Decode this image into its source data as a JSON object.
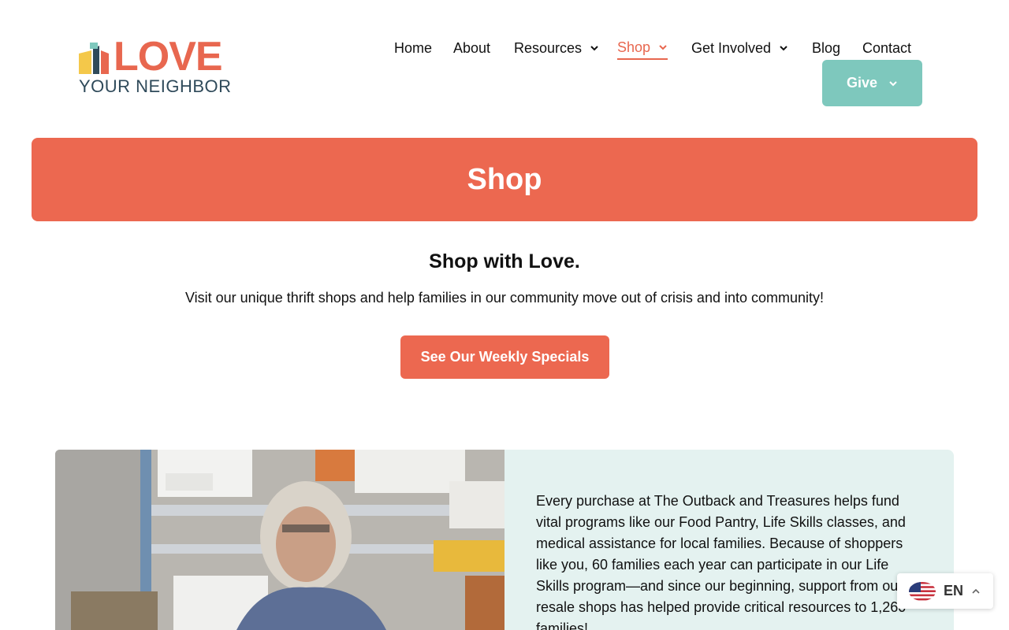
{
  "brand": {
    "word_love": "LOVE",
    "word_neighbor": "YOUR NEIGHBOR",
    "colors": {
      "coral": "#e8674f",
      "teal": "#7ec8bd",
      "navy": "#2f4a5a",
      "yellow": "#f4c84a",
      "mint_panel": "#e4f2f0"
    }
  },
  "nav": {
    "items": [
      {
        "label": "Home",
        "dropdown": false
      },
      {
        "label": "About",
        "dropdown": false
      },
      {
        "label": "Resources",
        "dropdown": true
      },
      {
        "label": "Shop",
        "dropdown": true,
        "active": true
      },
      {
        "label": "Get Involved",
        "dropdown": true
      },
      {
        "label": "Blog",
        "dropdown": false
      },
      {
        "label": "Contact",
        "dropdown": false
      }
    ],
    "give_label": "Give"
  },
  "banner": {
    "title": "Shop"
  },
  "intro": {
    "title": "Shop with Love.",
    "text": "Visit our unique thrift shops and help families in our community move out of crisis and into community!",
    "cta_label": "See Our Weekly Specials"
  },
  "feature": {
    "body": "Every purchase at The Outback and Treasures helps fund vital programs like our Food Pantry, Life Skills classes, and medical assistance for local families. Because of shoppers like you, 60 families each year can participate in our Life Skills program—and since our beginning, support from our resale shops has helped provide critical resources to 1,260 families!"
  },
  "language": {
    "code": "EN",
    "icon": "us-flag-icon"
  }
}
